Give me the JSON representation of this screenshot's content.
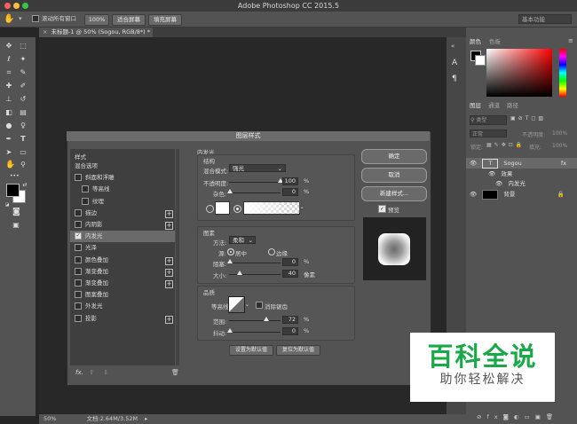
{
  "app": {
    "title": "Adobe Photoshop CC 2015.5"
  },
  "options_bar": {
    "scroll_all_windows": "滚动所有窗口",
    "zoom_100": "100%",
    "fit_screen": "适合屏幕",
    "fill_screen": "填充屏幕",
    "workspace": "基本功能"
  },
  "document": {
    "tab_label": "未标题-1 @ 50% (Sogou, RGB/8*) *",
    "zoom": "50%",
    "doc_info": "文档:2.64M/3.52M"
  },
  "right_panel": {
    "tabs_top": [
      "颜色",
      "色板"
    ],
    "tabs_layers": [
      "图层",
      "通道",
      "路径"
    ],
    "kind": "类型",
    "blend": "正常",
    "opacity": "不透明度:",
    "opacity_value": "100%",
    "lock": "锁定:",
    "fill": "填充:",
    "fill_value": "100%",
    "layers": [
      {
        "name": "Sogou",
        "kind": "text"
      },
      {
        "name": "效果",
        "kind": "effects"
      },
      {
        "name": "内发光",
        "kind": "effect"
      },
      {
        "name": "背景",
        "kind": "background"
      }
    ]
  },
  "dialog": {
    "title": "图层样式",
    "styles_header": "样式",
    "style_items": [
      {
        "label": "混合选项",
        "has_check": false,
        "has_plus": false,
        "checked": false,
        "indent": false
      },
      {
        "label": "斜面和浮雕",
        "has_check": true,
        "has_plus": false,
        "checked": false,
        "indent": false
      },
      {
        "label": "等高线",
        "has_check": true,
        "has_plus": false,
        "checked": false,
        "indent": true
      },
      {
        "label": "纹理",
        "has_check": true,
        "has_plus": false,
        "checked": false,
        "indent": true
      },
      {
        "label": "描边",
        "has_check": true,
        "has_plus": true,
        "checked": false,
        "indent": false
      },
      {
        "label": "内阴影",
        "has_check": true,
        "has_plus": true,
        "checked": false,
        "indent": false
      },
      {
        "label": "内发光",
        "has_check": true,
        "has_plus": false,
        "checked": true,
        "indent": false
      },
      {
        "label": "光泽",
        "has_check": true,
        "has_plus": false,
        "checked": false,
        "indent": false
      },
      {
        "label": "颜色叠加",
        "has_check": true,
        "has_plus": true,
        "checked": false,
        "indent": false
      },
      {
        "label": "渐变叠加",
        "has_check": true,
        "has_plus": true,
        "checked": false,
        "indent": false
      },
      {
        "label": "渐变叠加",
        "has_check": true,
        "has_plus": true,
        "checked": false,
        "indent": false
      },
      {
        "label": "图案叠加",
        "has_check": true,
        "has_plus": false,
        "checked": false,
        "indent": false
      },
      {
        "label": "外发光",
        "has_check": true,
        "has_plus": false,
        "checked": false,
        "indent": false
      },
      {
        "label": "投影",
        "has_check": true,
        "has_plus": true,
        "checked": false,
        "indent": false
      }
    ],
    "fx": "fx.",
    "inner_glow": {
      "title": "内发光",
      "structure": "结构",
      "blend_mode_label": "混合模式:",
      "blend_mode": "强光",
      "opacity_label": "不透明度:",
      "opacity": "100",
      "noise_label": "杂色:",
      "noise": "0",
      "percent": "%",
      "elements": "图素",
      "method_label": "方法:",
      "method": "柔和",
      "source_label": "源:",
      "source_center": "居中",
      "source_edge": "边缘",
      "choke_label": "阻塞:",
      "choke": "0",
      "size_label": "大小:",
      "size": "40",
      "px": "像素",
      "quality": "品质",
      "contour_label": "等高线:",
      "antialias": "消除锯齿",
      "range_label": "范围:",
      "range": "72",
      "jitter_label": "抖动:",
      "jitter": "0",
      "make_default": "设置为默认值",
      "reset_default": "复位为默认值"
    },
    "buttons": {
      "ok": "确定",
      "cancel": "取消",
      "new_style": "新建样式...",
      "preview": "预览"
    }
  },
  "watermark": {
    "main": "百科全说",
    "sub": "助你轻松解决"
  }
}
